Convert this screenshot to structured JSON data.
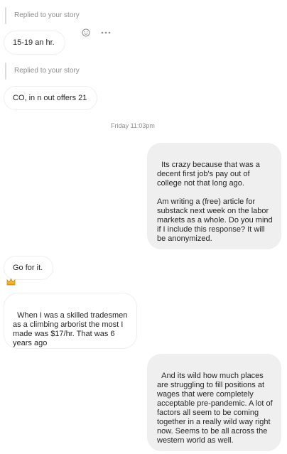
{
  "messages": [
    {
      "reply_label": "Replied to your story",
      "text": "15-19 an hr."
    },
    {
      "reply_label": "Replied to your story",
      "text": "CO, in n out offers 21"
    }
  ],
  "timestamp": "Friday 11:03pm",
  "outgoing": [
    {
      "text": "Its crazy because that was a decent first job's pay out of college not that long ago.\n\nAm writing a (free) article for substack next week on the labor markets as a whole. Do you mind if I include this response? It will be anonymized."
    },
    {
      "text": "And its wild how much places are struggling to fill positions at wages that were completely acceptable pre-pandemic. A lot of factors all seem to be coming together in a really wild way right now. Seems to be all across the western world as well."
    }
  ],
  "incoming": [
    {
      "text": "Go for it."
    },
    {
      "text": "When I was a skilled tradesmen as a climbing arborist the most I made was $17/hr. That was 6 years ago"
    }
  ],
  "icons": {
    "react": "smiley-icon",
    "more": "more-dots-icon",
    "reaction": "crown-emoji-icon"
  }
}
